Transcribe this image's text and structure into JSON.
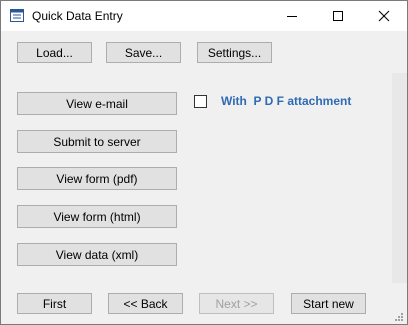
{
  "window": {
    "title": "Quick Data Entry"
  },
  "toolbar": {
    "load": "Load...",
    "save": "Save...",
    "settings": "Settings..."
  },
  "actions": {
    "view_email": "View e-mail",
    "submit": "Submit to server",
    "view_pdf": "View form (pdf)",
    "view_html": "View form (html)",
    "view_xml": "View data (xml)"
  },
  "attachment": {
    "label": "With  P D F attachment",
    "checked": false
  },
  "nav": {
    "first": "First",
    "back": "<< Back",
    "next": "Next >>",
    "start_new": "Start new"
  },
  "colors": {
    "accent": "#2f6ab5",
    "button": "#e1e1e1",
    "disabled_text": "#a0a0a0"
  }
}
